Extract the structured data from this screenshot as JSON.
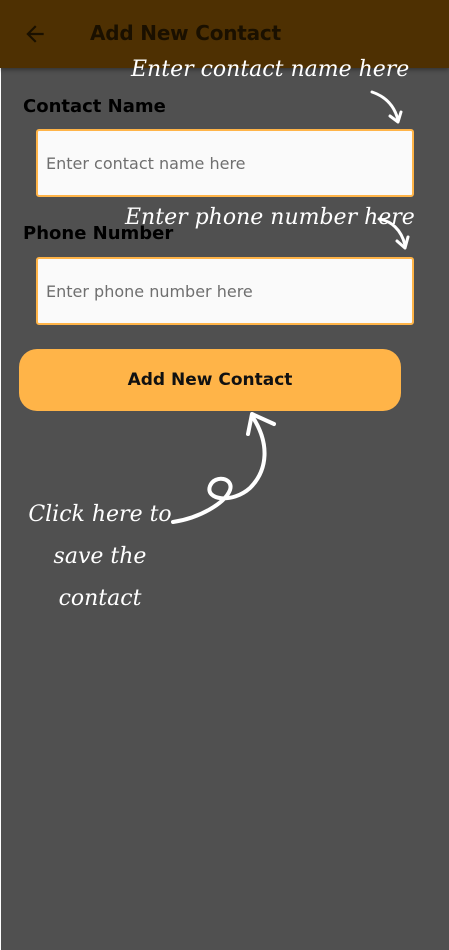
{
  "app_bar": {
    "back_icon": "arrow-left-icon",
    "title": "Add New Contact",
    "background": "#4e3002"
  },
  "form": {
    "name": {
      "label": "Contact Name",
      "value": "",
      "placeholder": "Enter contact name here"
    },
    "phone": {
      "label": "Phone Number",
      "value": "",
      "placeholder": "Enter phone number here"
    },
    "submit_label": "Add New Contact"
  },
  "annotations": {
    "name_hint": "Enter contact name here",
    "phone_hint": "Enter phone number here",
    "save_hint": [
      "Click here to",
      "save the",
      "contact"
    ]
  },
  "colors": {
    "accent": "#ffb448",
    "background": "#505050"
  }
}
